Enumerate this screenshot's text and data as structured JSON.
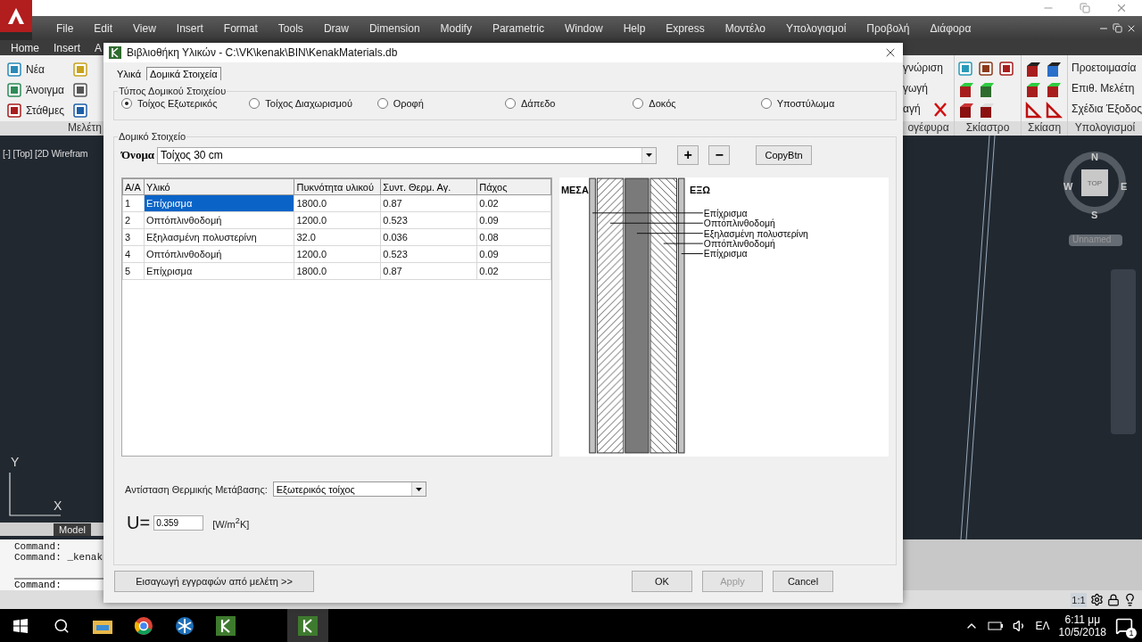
{
  "app": {
    "menu": [
      "File",
      "Edit",
      "View",
      "Insert",
      "Format",
      "Tools",
      "Draw",
      "Dimension",
      "Modify",
      "Parametric",
      "Window",
      "Help",
      "Express",
      "Μοντέλο",
      "Υπολογισμοί",
      "Προβολή",
      "Διάφορα"
    ],
    "ribbon_tabs": [
      "Home",
      "Insert",
      "A"
    ],
    "ribbon_left": {
      "buttons": [
        "Νέα",
        "Άνοιγμα",
        "Στάθμες"
      ],
      "panel": "Μελέτη"
    },
    "ribbon_right": {
      "labels": [
        "γνώριση",
        "γωγή",
        "αγή"
      ],
      "panels": [
        "ογέφυρα",
        "Σκίαστρο",
        "Σκίαση",
        "Υπολογισμοί"
      ],
      "commands": [
        "Προετοιμασία",
        "Επιθ. Μελέτη",
        "Σχέδια Έξοδος"
      ]
    },
    "viewport_label": "[-] [Top] [2D Wirefram",
    "viewcube": {
      "north": "N",
      "west": "W",
      "east": "E",
      "south": "S",
      "face": "TOP",
      "ucs": "Unnamed"
    },
    "ucs_axes": {
      "y": "Y",
      "x": "X"
    },
    "layout_tabs": [
      "Model"
    ],
    "command_lines": [
      "Command:",
      "Command:  _kenak"
    ],
    "command_prompt": "Command:",
    "status_scale": "1:1"
  },
  "dialog": {
    "title": "Βιβλιοθήκη Υλικών - C:\\VK\\kenak\\BIN\\KenakMaterials.db",
    "tabs": [
      {
        "label": "Υλικά",
        "selected": false
      },
      {
        "label": "Δομικά Στοιχεία",
        "selected": true
      }
    ],
    "element_type": {
      "title": "Τύπος Δομικού Στοιχείου",
      "options": [
        {
          "label": "Τοίχος Εξωτερικός",
          "selected": true
        },
        {
          "label": "Τοίχος Διαχωρισμού",
          "selected": false
        },
        {
          "label": "Οροφή",
          "selected": false
        },
        {
          "label": "Δάπεδο",
          "selected": false
        },
        {
          "label": "Δοκός",
          "selected": false
        },
        {
          "label": "Υποστύλωμα",
          "selected": false
        }
      ]
    },
    "element": {
      "title": "Δομικό Στοιχείο",
      "name_label": "Όνομα",
      "name": "Τοίχος 30 cm",
      "add": "+",
      "remove": "−",
      "copy": "CopyBtn",
      "table": {
        "columns": [
          "Α/Α",
          "Υλικό",
          "Πυκνότητα υλικού",
          "Συντ. Θερμ. Αγ.",
          "Πάχος"
        ],
        "rows": [
          {
            "cells": [
              "1",
              "Επίχρισμα",
              "1800.0",
              "0.87",
              "0.02"
            ],
            "selected": true
          },
          {
            "cells": [
              "2",
              "Οπτόπλινθοδομή",
              "1200.0",
              "0.523",
              "0.09"
            ],
            "selected": false
          },
          {
            "cells": [
              "3",
              "Εξηλασμένη πολυστερίνη",
              "32.0",
              "0.036",
              "0.08"
            ],
            "selected": false
          },
          {
            "cells": [
              "4",
              "Οπτόπλινθοδομή",
              "1200.0",
              "0.523",
              "0.09"
            ],
            "selected": false
          },
          {
            "cells": [
              "5",
              "Επίχρισμα",
              "1800.0",
              "0.87",
              "0.02"
            ],
            "selected": false
          }
        ]
      },
      "diagram": {
        "inside": "ΜΕΣΑ",
        "outside": "ΕΞΩ",
        "layers": [
          {
            "label": "Επίχρισμα",
            "kind": "plaster"
          },
          {
            "label": "Οπτόπλινθοδομή",
            "kind": "brick"
          },
          {
            "label": "Εξηλασμένη πολυστερίνη",
            "kind": "insulation"
          },
          {
            "label": "Οπτόπλινθοδομή",
            "kind": "brick"
          },
          {
            "label": "Επίχρισμα",
            "kind": "plaster"
          }
        ]
      },
      "resistance_label": "Αντίσταση Θερμικής Μετάβασης:",
      "resistance": "Εξωτερικός τοίχος",
      "u_label": "U=",
      "u_value": "0.359",
      "u_unit": "[W/m$^{2}$K]"
    },
    "import_button": "Εισαγωγή εγγραφών από μελέτη >>",
    "buttons": [
      {
        "label": "OK",
        "disabled": false
      },
      {
        "label": "Apply",
        "disabled": true
      },
      {
        "label": "Cancel",
        "disabled": false
      }
    ]
  },
  "taskbar": {
    "language": "ΕΛ",
    "time": "6:11 μμ",
    "date": "10/5/2018",
    "notifications": "1"
  }
}
